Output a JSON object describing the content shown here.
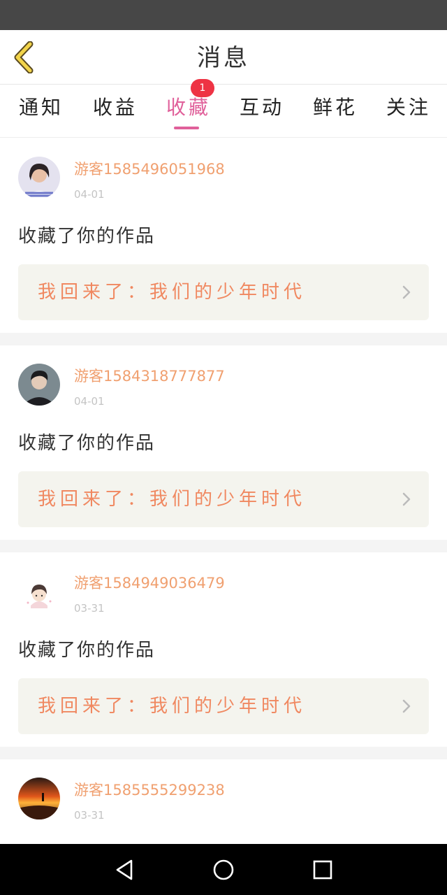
{
  "header": {
    "title": "消息",
    "back_icon": "chevron-left-icon"
  },
  "tabs": [
    {
      "label": "通知"
    },
    {
      "label": "收益"
    },
    {
      "label": "收藏",
      "active": true,
      "badge": "1"
    },
    {
      "label": "互动"
    },
    {
      "label": "鲜花"
    },
    {
      "label": "关注"
    }
  ],
  "colors": {
    "accent": "#e0609a",
    "username": "#f0a070",
    "work_title": "#f08860",
    "badge": "#ee3344"
  },
  "items": [
    {
      "username": "游客1585496051968",
      "date": "04-01",
      "action": "收藏了你的作品",
      "work_title": "我回来了：我们的少年时代"
    },
    {
      "username": "游客1584318777877",
      "date": "04-01",
      "action": "收藏了你的作品",
      "work_title": "我回来了：我们的少年时代"
    },
    {
      "username": "游客1584949036479",
      "date": "03-31",
      "action": "收藏了你的作品",
      "work_title": "我回来了：我们的少年时代"
    },
    {
      "username": "游客1585555299238",
      "date": "03-31"
    }
  ],
  "nav": {
    "back": "triangle-back-icon",
    "home": "circle-home-icon",
    "recent": "square-recent-icon"
  }
}
